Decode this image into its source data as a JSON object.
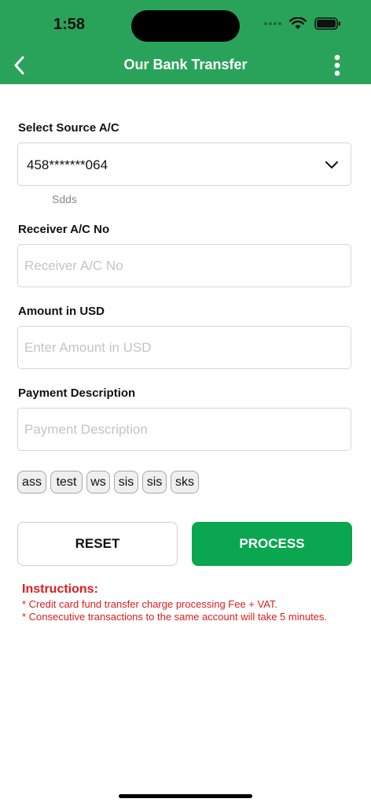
{
  "status_bar": {
    "time": "1:58"
  },
  "header": {
    "title": "Our Bank Transfer",
    "back_icon": "chevron-left-icon",
    "menu_icon": "more-vertical-icon"
  },
  "form": {
    "source": {
      "label": "Select Source A/C",
      "value": "458*******064",
      "sub_label": "Sdds"
    },
    "receiver": {
      "label": "Receiver A/C No",
      "placeholder": "Receiver A/C No"
    },
    "amount": {
      "label": "Amount in USD",
      "placeholder": "Enter Amount in USD"
    },
    "description": {
      "label": "Payment Description",
      "placeholder": "Payment Description"
    }
  },
  "chips": [
    "ass",
    "test",
    "ws",
    "sis",
    "sis",
    "sks"
  ],
  "actions": {
    "reset_label": "RESET",
    "process_label": "PROCESS"
  },
  "instructions": {
    "title": "Instructions:",
    "lines": [
      "* Credit card fund transfer charge processing Fee + VAT.",
      "* Consecutive transactions to the same account will take 5 minutes."
    ]
  },
  "colors": {
    "header_bg": "#2aa35a",
    "process_bg": "#0aa650",
    "instruction_text": "#e01b1b"
  }
}
